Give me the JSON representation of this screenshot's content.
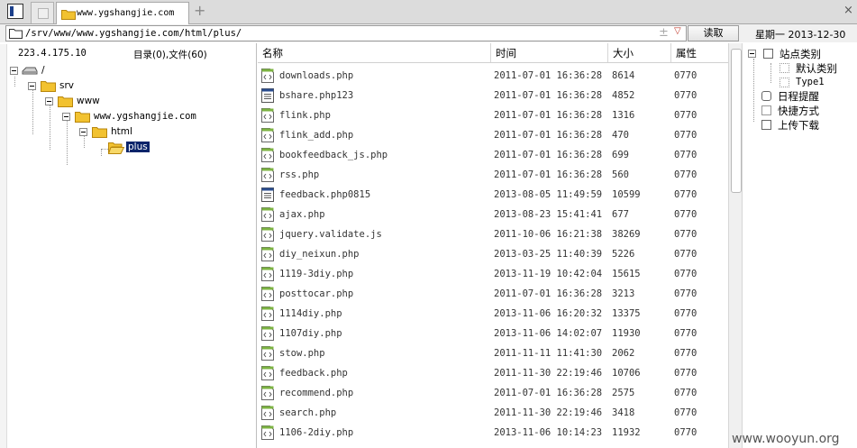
{
  "tab": {
    "title": "www.ygshangjie.com"
  },
  "address": {
    "path": "/srv/www/www.ygshangjie.com/html/plus/",
    "read_button": "读取",
    "date": "星期一 2013-12-30"
  },
  "left": {
    "ip": "223.4.175.10",
    "summary": "目录(0),文件(60)",
    "tree": [
      {
        "label": "/"
      },
      {
        "label": "srv"
      },
      {
        "label": "www"
      },
      {
        "label": "www.ygshangjie.com"
      },
      {
        "label": "html"
      },
      {
        "label": "plus"
      }
    ]
  },
  "list": {
    "headers": {
      "name": "名称",
      "time": "时间",
      "size": "大小",
      "attr": "属性"
    },
    "files": [
      {
        "name": "downloads.php",
        "time": "2011-07-01 16:36:28",
        "size": "8614",
        "attr": "0770",
        "icon": "php-file-icon"
      },
      {
        "name": "bshare.php123",
        "time": "2011-07-01 16:36:28",
        "size": "4852",
        "attr": "0770",
        "icon": "generic-file-icon"
      },
      {
        "name": "flink.php",
        "time": "2011-07-01 16:36:28",
        "size": "1316",
        "attr": "0770",
        "icon": "php-file-icon"
      },
      {
        "name": "flink_add.php",
        "time": "2011-07-01 16:36:28",
        "size": "470",
        "attr": "0770",
        "icon": "php-file-icon"
      },
      {
        "name": "bookfeedback_js.php",
        "time": "2011-07-01 16:36:28",
        "size": "699",
        "attr": "0770",
        "icon": "php-file-icon"
      },
      {
        "name": "rss.php",
        "time": "2011-07-01 16:36:28",
        "size": "560",
        "attr": "0770",
        "icon": "php-file-icon"
      },
      {
        "name": "feedback.php0815",
        "time": "2013-08-05 11:49:59",
        "size": "10599",
        "attr": "0770",
        "icon": "generic-file-icon"
      },
      {
        "name": "ajax.php",
        "time": "2013-08-23 15:41:41",
        "size": "677",
        "attr": "0770",
        "icon": "php-file-icon"
      },
      {
        "name": "jquery.validate.js",
        "time": "2011-10-06 16:21:38",
        "size": "38269",
        "attr": "0770",
        "icon": "php-file-icon"
      },
      {
        "name": "diy_neixun.php",
        "time": "2013-03-25 11:40:39",
        "size": "5226",
        "attr": "0770",
        "icon": "php-file-icon"
      },
      {
        "name": "1119-3diy.php",
        "time": "2013-11-19 10:42:04",
        "size": "15615",
        "attr": "0770",
        "icon": "php-file-icon"
      },
      {
        "name": "posttocar.php",
        "time": "2011-07-01 16:36:28",
        "size": "3213",
        "attr": "0770",
        "icon": "php-file-icon"
      },
      {
        "name": "1114diy.php",
        "time": "2013-11-06 16:20:32",
        "size": "13375",
        "attr": "0770",
        "icon": "php-file-icon"
      },
      {
        "name": "1107diy.php",
        "time": "2013-11-06 14:02:07",
        "size": "11930",
        "attr": "0770",
        "icon": "php-file-icon"
      },
      {
        "name": "stow.php",
        "time": "2011-11-11 11:41:30",
        "size": "2062",
        "attr": "0770",
        "icon": "php-file-icon"
      },
      {
        "name": "feedback.php",
        "time": "2011-11-30 22:19:46",
        "size": "10706",
        "attr": "0770",
        "icon": "php-file-icon"
      },
      {
        "name": "recommend.php",
        "time": "2011-07-01 16:36:28",
        "size": "2575",
        "attr": "0770",
        "icon": "php-file-icon"
      },
      {
        "name": "search.php",
        "time": "2011-11-30 22:19:46",
        "size": "3418",
        "attr": "0770",
        "icon": "php-file-icon"
      },
      {
        "name": "1106-2diy.php",
        "time": "2013-11-06 10:14:23",
        "size": "11932",
        "attr": "0770",
        "icon": "php-file-icon"
      }
    ]
  },
  "right": {
    "items": [
      {
        "label": "站点类别"
      },
      {
        "label": "默认类别"
      },
      {
        "label": "Type1"
      },
      {
        "label": "日程提醒"
      },
      {
        "label": "快捷方式"
      },
      {
        "label": "上传下载"
      }
    ]
  },
  "watermark": "www.wooyun.org",
  "colors": {
    "selection": "#0a246a",
    "folder": "#f2c230"
  }
}
